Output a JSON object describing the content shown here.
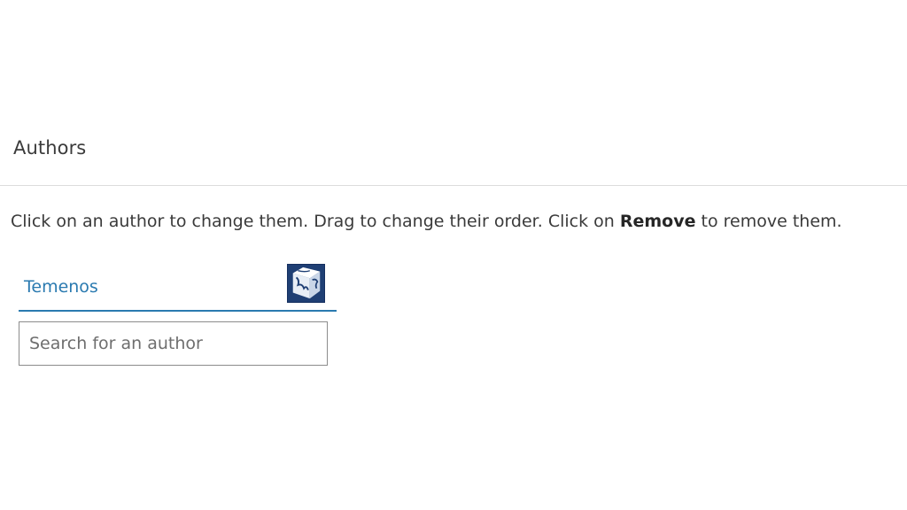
{
  "section": {
    "title": "Authors"
  },
  "instructions": {
    "before": "Click on an author to change them. Drag to change their order. Click on ",
    "emphasis": "Remove",
    "after": " to remove them."
  },
  "authors": [
    {
      "name": "Temenos",
      "logo_icon": "temenos-logo-icon"
    }
  ],
  "search": {
    "placeholder": "Search for an author",
    "value": ""
  },
  "colors": {
    "link": "#2a7ab0",
    "logo_bg": "#1f3f74"
  }
}
